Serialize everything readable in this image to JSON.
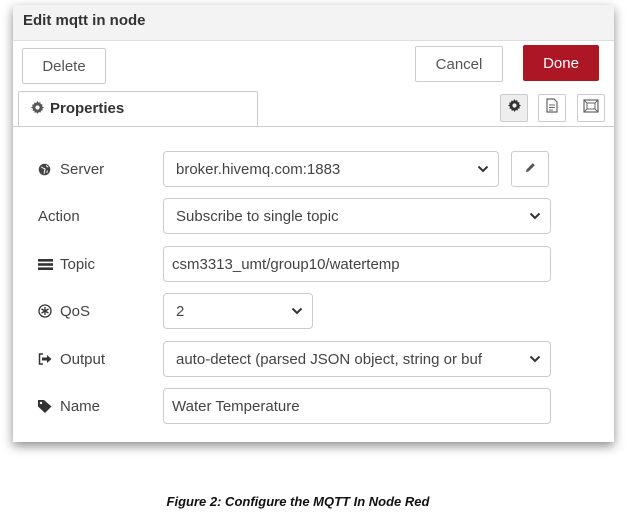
{
  "dialog": {
    "title": "Edit mqtt in node",
    "buttons": {
      "delete": "Delete",
      "cancel": "Cancel",
      "done": "Done"
    },
    "tabs": {
      "properties": "Properties"
    },
    "accent_color": "#ad1625"
  },
  "form": {
    "server": {
      "label": "Server",
      "value": "broker.hivemq.com:1883"
    },
    "action": {
      "label": "Action",
      "value": "Subscribe to single topic"
    },
    "topic": {
      "label": "Topic",
      "value": "csm3313_umt/group10/watertemp"
    },
    "qos": {
      "label": "QoS",
      "value": "2"
    },
    "output": {
      "label": "Output",
      "value": "auto-detect (parsed JSON object, string or buf"
    },
    "name": {
      "label": "Name",
      "value": "Water Temperature"
    }
  },
  "icons": [
    "gear-icon",
    "globe-icon",
    "topic-list-icon",
    "qos-icon",
    "output-icon",
    "tag-icon",
    "pencil-icon",
    "info-icon",
    "frame-icon",
    "chevron-down-icon"
  ],
  "caption": "Figure 2: Configure the MQTT In Node Red"
}
